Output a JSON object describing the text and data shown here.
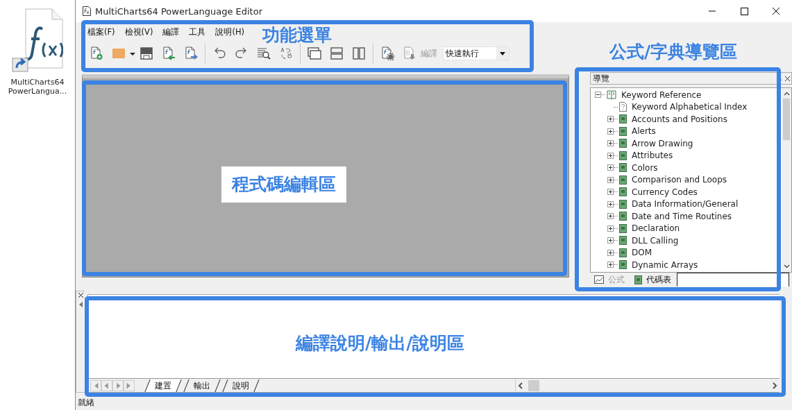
{
  "desktop_icon": {
    "label": "MultiCharts64 PowerLangua..."
  },
  "window": {
    "title": "MultiCharts64 PowerLanguage Editor"
  },
  "menu": [
    "檔案(F)",
    "檢視(V)",
    "編譯",
    "工具",
    "說明(H)"
  ],
  "toolbar": {
    "compile_label": "編譯",
    "compile_disabled": true,
    "mode_select": {
      "value": "快速執行"
    }
  },
  "navigator": {
    "title": "導覽",
    "tree": [
      {
        "label": "Keyword Reference",
        "kind": "root",
        "expanded": true,
        "children": [
          {
            "label": "Keyword Alphabetical Index",
            "kind": "help"
          },
          {
            "label": "Accounts and Positions",
            "kind": "book",
            "expanded": false
          },
          {
            "label": "Alerts",
            "kind": "book",
            "expanded": false
          },
          {
            "label": "Arrow Drawing",
            "kind": "book",
            "expanded": false
          },
          {
            "label": "Attributes",
            "kind": "book",
            "expanded": false
          },
          {
            "label": "Colors",
            "kind": "book",
            "expanded": false
          },
          {
            "label": "Comparison and Loops",
            "kind": "book",
            "expanded": false
          },
          {
            "label": "Currency Codes",
            "kind": "book",
            "expanded": false
          },
          {
            "label": "Data Information/General",
            "kind": "book",
            "expanded": false
          },
          {
            "label": "Date and Time Routines",
            "kind": "book",
            "expanded": false
          },
          {
            "label": "Declaration",
            "kind": "book",
            "expanded": false
          },
          {
            "label": "DLL Calling",
            "kind": "book",
            "expanded": false
          },
          {
            "label": "DOM",
            "kind": "book",
            "expanded": false
          },
          {
            "label": "Dynamic Arrays",
            "kind": "book",
            "expanded": false
          }
        ]
      }
    ],
    "tabs": [
      {
        "label": "公式",
        "kind": "formula",
        "selected": false
      },
      {
        "label": "代碼表",
        "kind": "dictionary",
        "selected": true
      }
    ]
  },
  "output": {
    "tabs": [
      {
        "label": "建置",
        "selected": true
      },
      {
        "label": "輸出",
        "selected": false
      },
      {
        "label": "說明",
        "selected": false
      }
    ]
  },
  "status_bar": {
    "text": "就緒"
  },
  "annotations": [
    {
      "label": "功能選單"
    },
    {
      "label": "公式/字典導覽區"
    },
    {
      "label": "程式碼編輯區"
    },
    {
      "label": "編譯說明/輸出/說明區"
    }
  ]
}
